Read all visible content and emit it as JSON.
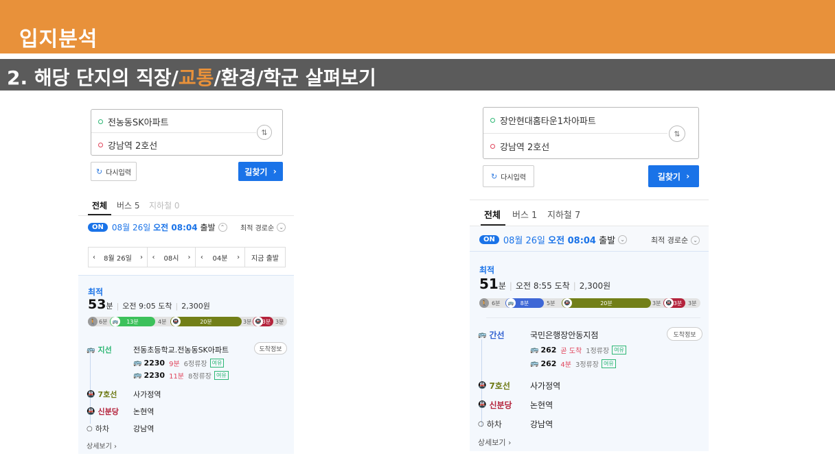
{
  "slide": {
    "title": "입지분석",
    "subtitle_pre": "2. 해당 단지의 직장/",
    "subtitle_accent": "교통",
    "subtitle_post": "/환경/학군 살펴보기",
    "accent_color": "#e8913a"
  },
  "left": {
    "origin": "전농동SK아파트",
    "destination": "강남역 2호선",
    "retry_label": "다시입력",
    "search_label": "길찾기",
    "tabs": [
      {
        "label": "전체"
      },
      {
        "label": "버스 5"
      },
      {
        "label": "지하철 0"
      }
    ],
    "on_badge": "ON",
    "depart_date": "08월 26일",
    "depart_time": "오전 08:04",
    "depart_suffix": "출발",
    "sort_label": "최적 경로순",
    "picker": [
      "8월 26일",
      "08시",
      "04분",
      "지금 출발"
    ],
    "best_label": "최적",
    "duration_num": "53",
    "duration_unit": "분",
    "arrive": "오전 9:05 도착",
    "fare": "2,300원",
    "segments": {
      "walk1": "6분",
      "seg1": "13분",
      "walk2": "4분",
      "seg2": "20분",
      "walk3": "3분",
      "seg3": "3분",
      "walk4": "3분"
    },
    "steps": [
      {
        "line": "지선",
        "station": "전동초등학교.전농동SK아파트"
      },
      {
        "line": "7호선",
        "station": "사가정역"
      },
      {
        "line": "신분당",
        "station": "논현역"
      },
      {
        "line": "하차",
        "station": "강남역"
      }
    ],
    "arrive_info_label": "도착정보",
    "buses": [
      {
        "no": "2230",
        "eta": "9분",
        "stops": "6정류장",
        "tag": "여유"
      },
      {
        "no": "2230",
        "eta": "11분",
        "stops": "8정류장",
        "tag": "여유"
      }
    ],
    "detail_label": "상세보기"
  },
  "right": {
    "origin": "장안현대홈타운1차아파트",
    "destination": "강남역 2호선",
    "retry_label": "다시입력",
    "search_label": "길찾기",
    "tabs": [
      {
        "label": "전체"
      },
      {
        "label": "버스 1"
      },
      {
        "label": "지하철 7"
      }
    ],
    "on_badge": "ON",
    "depart_date": "08월 26일",
    "depart_time": "오전 08:04",
    "depart_suffix": "출발",
    "sort_label": "최적 경로순",
    "best_label": "최적",
    "duration_num": "51",
    "duration_unit": "분",
    "arrive": "오전 8:55 도착",
    "fare": "2,300원",
    "segments": {
      "walk1": "6분",
      "seg1": "8분",
      "walk2": "5분",
      "seg2": "20분",
      "walk3": "3분",
      "seg3": "3분",
      "walk4": "3분"
    },
    "steps": [
      {
        "line": "간선",
        "station": "국민은행장안동지점"
      },
      {
        "line": "7호선",
        "station": "사가정역"
      },
      {
        "line": "신분당",
        "station": "논현역"
      },
      {
        "line": "하차",
        "station": "강남역"
      }
    ],
    "arrive_info_label": "도착정보",
    "buses": [
      {
        "no": "262",
        "eta": "곧 도착",
        "stops": "1정류장",
        "tag": "여유"
      },
      {
        "no": "262",
        "eta": "4분",
        "stops": "3정류장",
        "tag": "여유"
      }
    ],
    "detail_label": "상세보기"
  }
}
